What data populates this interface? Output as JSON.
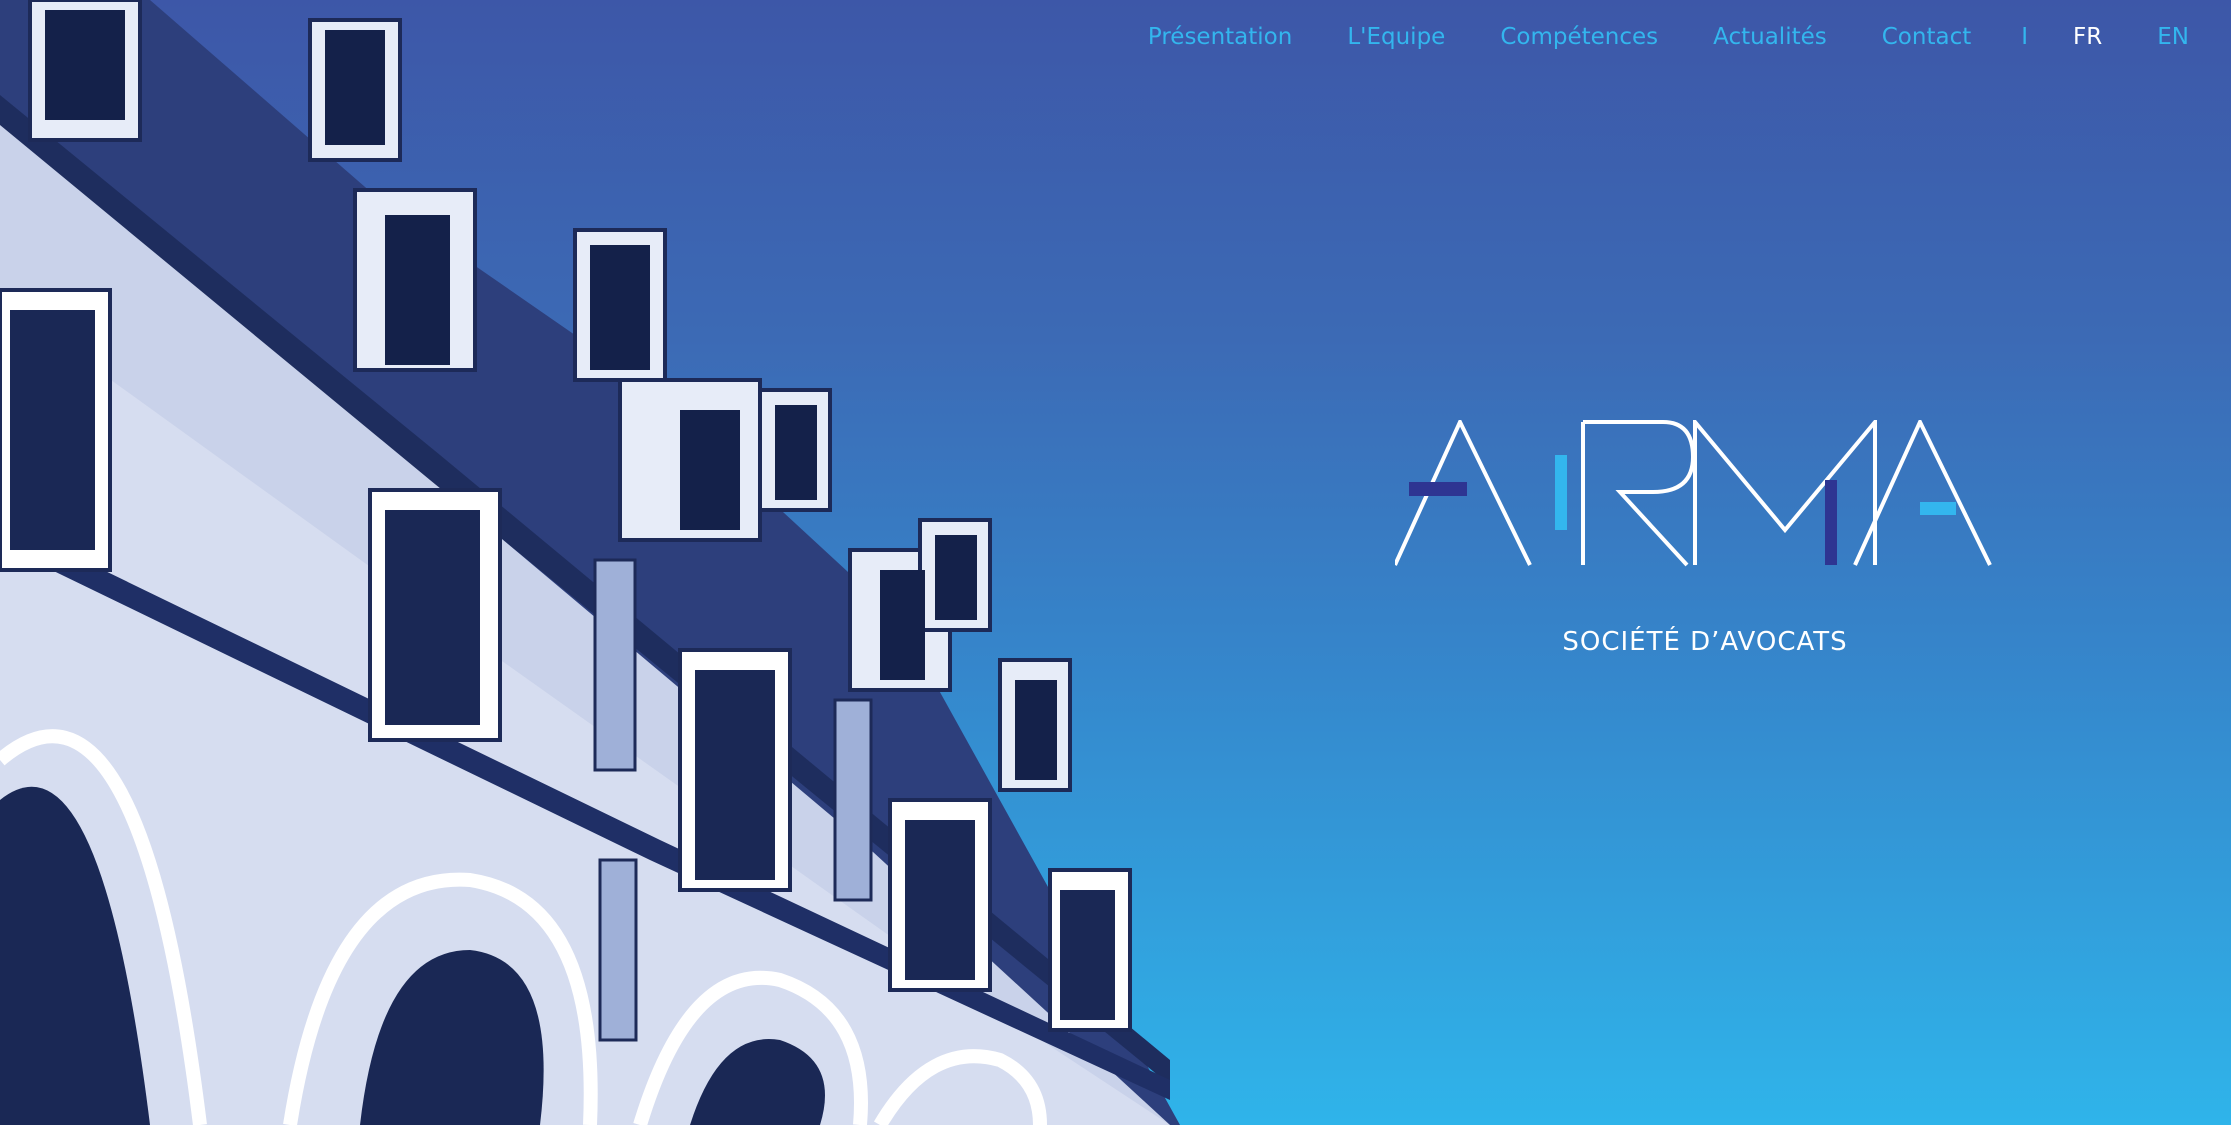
{
  "nav": {
    "items": [
      {
        "label": "Présentation"
      },
      {
        "label": "L'Equipe"
      },
      {
        "label": "Compétences"
      },
      {
        "label": "Actualités"
      },
      {
        "label": "Contact"
      }
    ],
    "separator": "I",
    "languages": {
      "fr": "FR",
      "en": "EN",
      "active": "FR"
    }
  },
  "brand": {
    "logo_text": "ARMA",
    "tagline": "SOCIÉTÉ D’AVOCATS"
  },
  "colors": {
    "nav_link": "#33b6ee",
    "active_lang": "#ffffff",
    "logo_accent_dark": "#2e3592",
    "logo_accent_light": "#33b6ee",
    "background_top": "#3d57a8",
    "background_bottom": "#2fb4ea"
  }
}
